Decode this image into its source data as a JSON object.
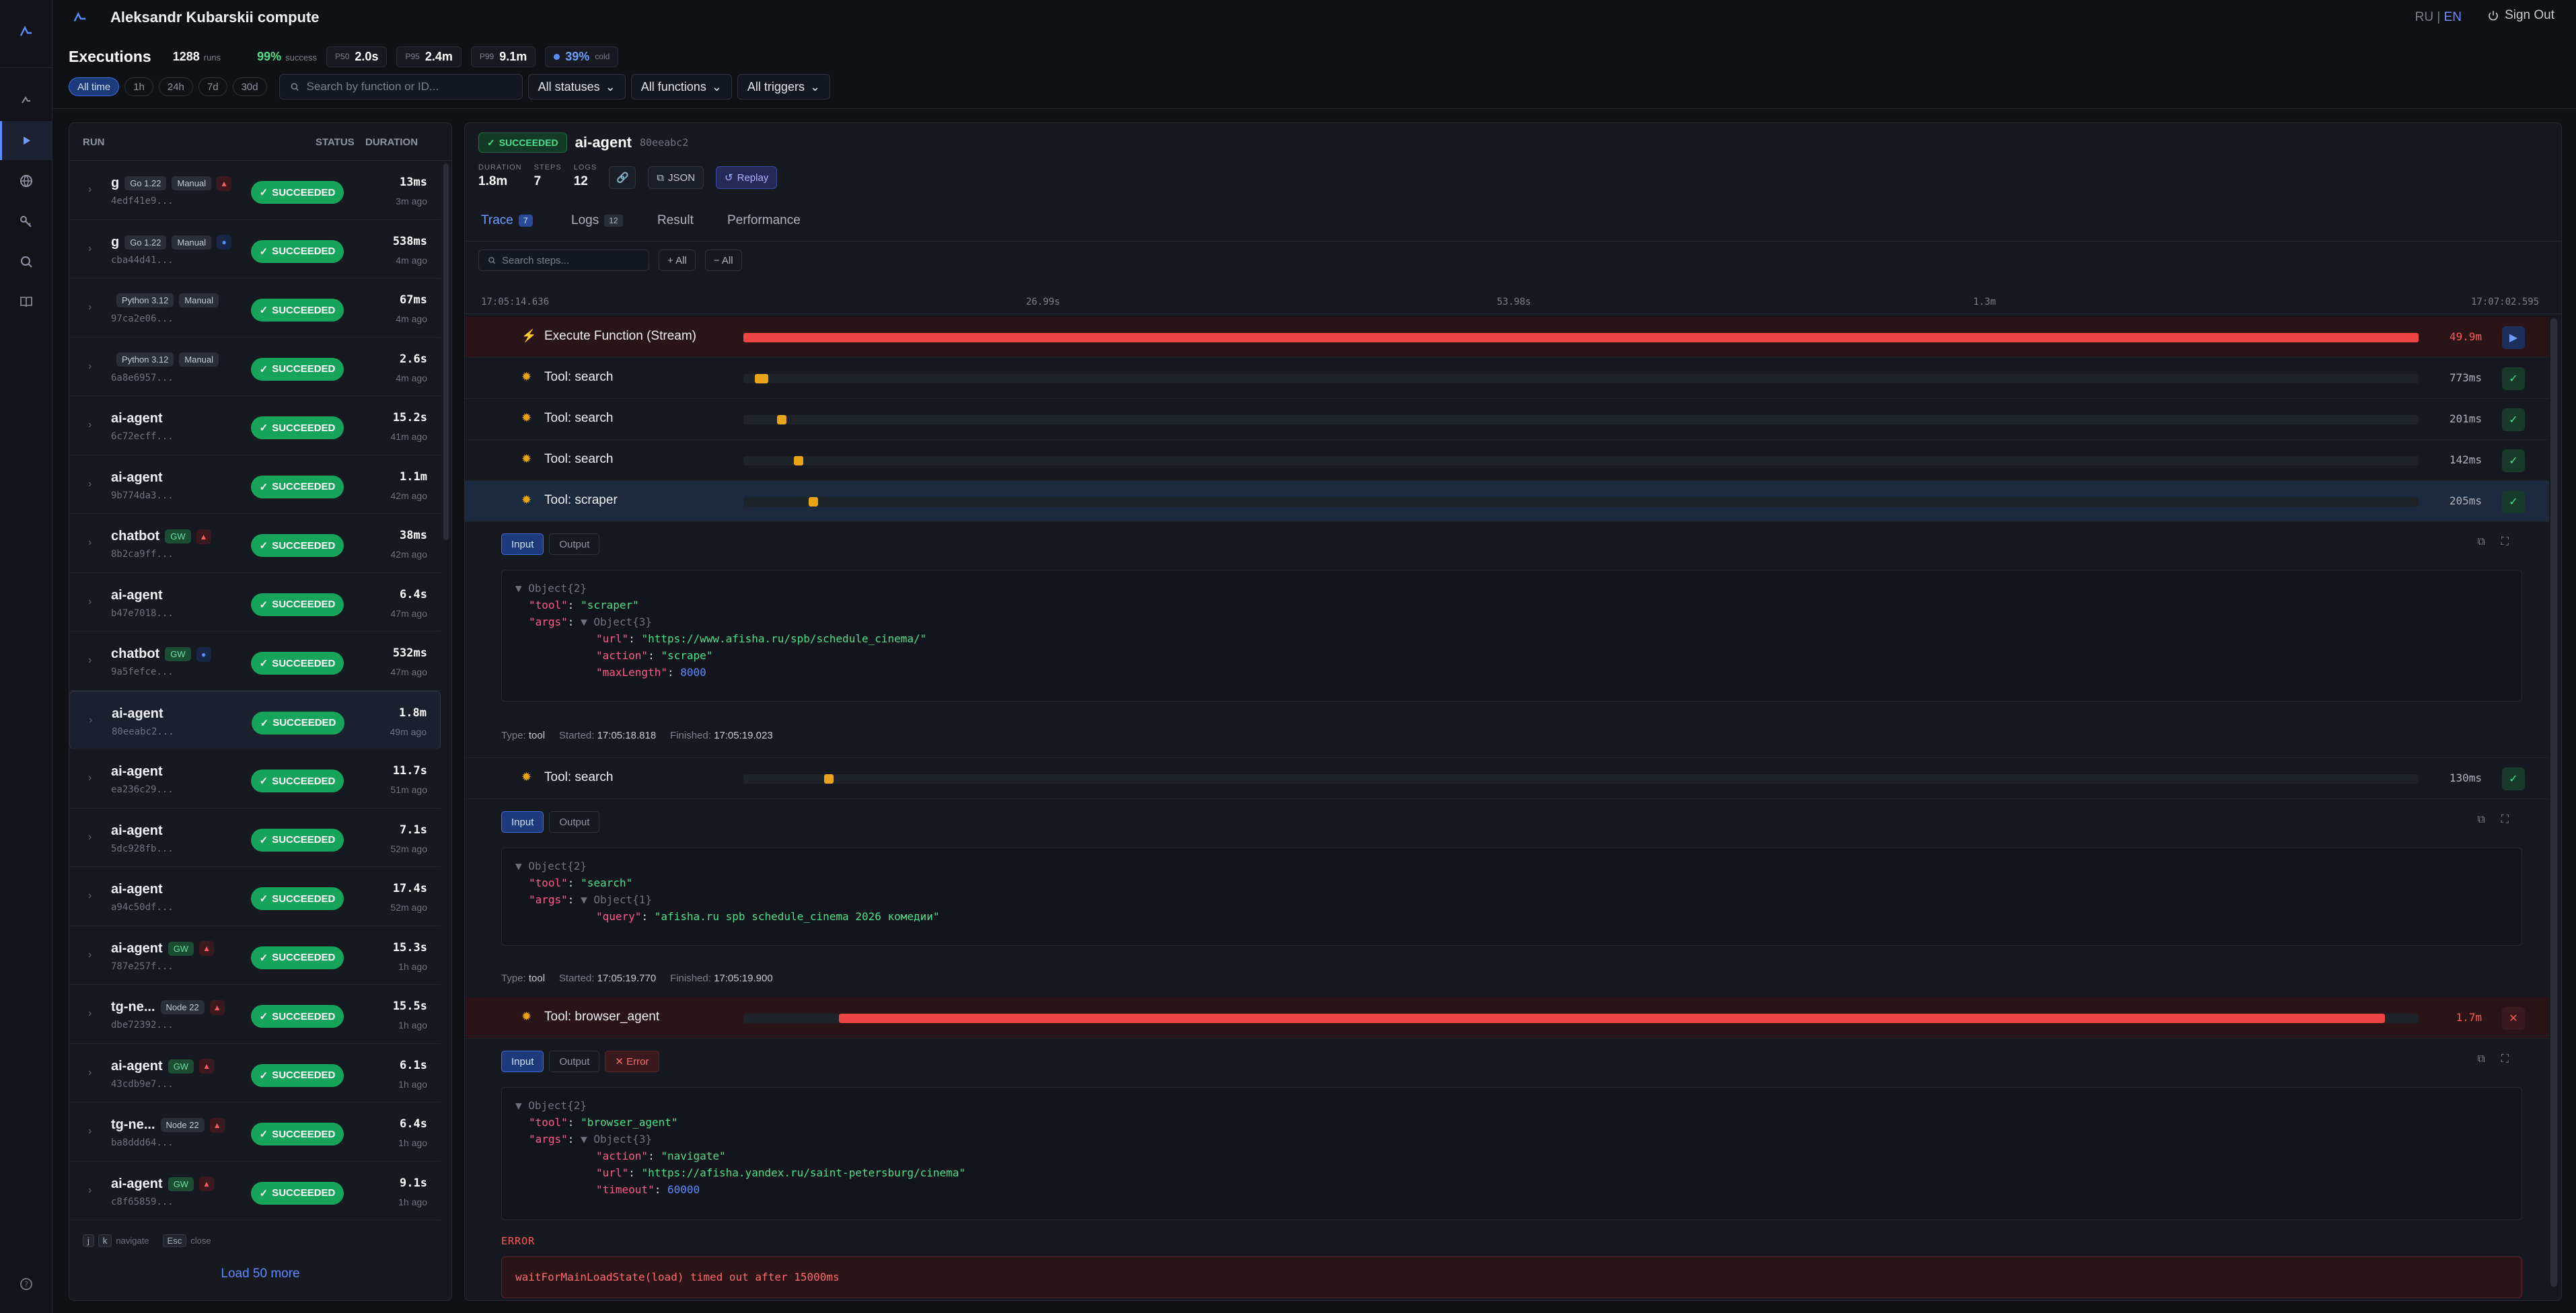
{
  "app": {
    "title": "Aleksandr Kubarskii compute",
    "lang_ru": "RU",
    "lang_sep": "|",
    "lang_en": "EN",
    "sign_out": "Sign Out"
  },
  "header": {
    "title": "Executions",
    "runs": "1288",
    "runs_label": "runs",
    "success": "99%",
    "success_label": "success",
    "p50_label": "P50",
    "p50": "2.0s",
    "p95_label": "P95",
    "p95": "2.4m",
    "p99_label": "P99",
    "p99": "9.1m",
    "cold": "39%",
    "cold_label": "cold"
  },
  "filters": {
    "time": [
      "All time",
      "1h",
      "24h",
      "7d",
      "30d"
    ],
    "search_placeholder": "Search by function or ID...",
    "statuses": "All statuses",
    "functions": "All functions",
    "triggers": "All triggers"
  },
  "list": {
    "col_run": "RUN",
    "col_status": "STATUS",
    "col_duration": "DURATION",
    "rows": [
      {
        "name": "g",
        "tags": [
          "Go 1.22",
          "Manual"
        ],
        "icon": "tri",
        "id": "4edf41e9...",
        "status": "SUCCEEDED",
        "dur": "13ms",
        "ago": "3m ago"
      },
      {
        "name": "g",
        "tags": [
          "Go 1.22",
          "Manual"
        ],
        "icon": "cir",
        "id": "cba44d41...",
        "status": "SUCCEEDED",
        "dur": "538ms",
        "ago": "4m ago"
      },
      {
        "name": "",
        "tags": [
          "Python 3.12",
          "Manual"
        ],
        "icon": "",
        "id": "97ca2e06...",
        "status": "SUCCEEDED",
        "dur": "67ms",
        "ago": "4m ago"
      },
      {
        "name": "",
        "tags": [
          "Python 3.12",
          "Manual"
        ],
        "icon": "",
        "id": "6a8e6957...",
        "status": "SUCCEEDED",
        "dur": "2.6s",
        "ago": "4m ago"
      },
      {
        "name": "ai-agent",
        "tags": [],
        "icon": "",
        "id": "6c72ecff...",
        "status": "SUCCEEDED",
        "dur": "15.2s",
        "ago": "41m ago"
      },
      {
        "name": "ai-agent",
        "tags": [],
        "icon": "",
        "id": "9b774da3...",
        "status": "SUCCEEDED",
        "dur": "1.1m",
        "ago": "42m ago"
      },
      {
        "name": "chatbot",
        "tags": [
          "GW"
        ],
        "icon": "tri",
        "id": "8b2ca9ff...",
        "status": "SUCCEEDED",
        "dur": "38ms",
        "ago": "42m ago"
      },
      {
        "name": "ai-agent",
        "tags": [],
        "icon": "",
        "id": "b47e7018...",
        "status": "SUCCEEDED",
        "dur": "6.4s",
        "ago": "47m ago"
      },
      {
        "name": "chatbot",
        "tags": [
          "GW"
        ],
        "icon": "cir",
        "id": "9a5fefce...",
        "status": "SUCCEEDED",
        "dur": "532ms",
        "ago": "47m ago"
      },
      {
        "name": "ai-agent",
        "tags": [],
        "icon": "",
        "id": "80eeabc2...",
        "status": "SUCCEEDED",
        "dur": "1.8m",
        "ago": "49m ago"
      },
      {
        "name": "ai-agent",
        "tags": [],
        "icon": "",
        "id": "ea236c29...",
        "status": "SUCCEEDED",
        "dur": "11.7s",
        "ago": "51m ago"
      },
      {
        "name": "ai-agent",
        "tags": [],
        "icon": "",
        "id": "5dc928fb...",
        "status": "SUCCEEDED",
        "dur": "7.1s",
        "ago": "52m ago"
      },
      {
        "name": "ai-agent",
        "tags": [],
        "icon": "",
        "id": "a94c50df...",
        "status": "SUCCEEDED",
        "dur": "17.4s",
        "ago": "52m ago"
      },
      {
        "name": "ai-agent",
        "tags": [
          "GW"
        ],
        "icon": "tri",
        "id": "787e257f...",
        "status": "SUCCEEDED",
        "dur": "15.3s",
        "ago": "1h ago"
      },
      {
        "name": "tg-ne...",
        "tags": [
          "Node 22"
        ],
        "icon": "tri",
        "id": "dbe72392...",
        "status": "SUCCEEDED",
        "dur": "15.5s",
        "ago": "1h ago"
      },
      {
        "name": "ai-agent",
        "tags": [
          "GW"
        ],
        "icon": "tri",
        "id": "43cdb9e7...",
        "status": "SUCCEEDED",
        "dur": "6.1s",
        "ago": "1h ago"
      },
      {
        "name": "tg-ne...",
        "tags": [
          "Node 22"
        ],
        "icon": "tri",
        "id": "ba8ddd64...",
        "status": "SUCCEEDED",
        "dur": "6.4s",
        "ago": "1h ago"
      },
      {
        "name": "ai-agent",
        "tags": [
          "GW"
        ],
        "icon": "tri",
        "id": "c8f65859...",
        "status": "SUCCEEDED",
        "dur": "9.1s",
        "ago": "1h ago"
      }
    ],
    "kb_j": "j",
    "kb_k": "k",
    "kb_nav": "navigate",
    "kb_esc": "Esc",
    "kb_close": "close",
    "load_more": "Load 50 more"
  },
  "detail": {
    "status": "SUCCEEDED",
    "fn": "ai-agent",
    "hash": "80eeabc2",
    "duration_label": "DURATION",
    "duration": "1.8m",
    "steps_label": "STEPS",
    "steps": "7",
    "logs_label": "LOGS",
    "logs": "12",
    "json": "JSON",
    "replay": "Replay",
    "tabs": [
      {
        "label": "Trace",
        "count": "7"
      },
      {
        "label": "Logs",
        "count": "12"
      },
      {
        "label": "Result",
        "count": ""
      },
      {
        "label": "Performance",
        "count": ""
      }
    ],
    "search_steps": "Search steps...",
    "expand_all": "+ All",
    "collapse_all": "− All",
    "ruler": [
      "17:05:14.636",
      "26.99s",
      "53.98s",
      "1.3m",
      "17:07:02.595"
    ],
    "spans": [
      {
        "name": "Execute Function (Stream)",
        "dur": "49.9m",
        "kind": "stream",
        "start": 0,
        "width": 1
      },
      {
        "name": "Tool: search",
        "dur": "773ms",
        "kind": "tool",
        "start": 0.007,
        "width": 0.008
      },
      {
        "name": "Tool: search",
        "dur": "201ms",
        "kind": "tool",
        "start": 0.02,
        "width": 0.005
      },
      {
        "name": "Tool: search",
        "dur": "142ms",
        "kind": "tool",
        "start": 0.03,
        "width": 0.004
      },
      {
        "name": "Tool: scraper",
        "dur": "205ms",
        "kind": "tool",
        "start": 0.039,
        "width": 0.005
      },
      {
        "name": "Tool: search",
        "dur": "130ms",
        "kind": "tool",
        "start": 0.048,
        "width": 0.004
      },
      {
        "name": "Tool: browser_agent",
        "dur": "1.7m",
        "kind": "err",
        "start": 0.057,
        "width": 0.923
      }
    ],
    "input": "Input",
    "output": "Output",
    "error": "Error",
    "d1": {
      "l1": "▼ Object{2}",
      "l2k": "\"tool\"",
      "l2v": "\"scraper\"",
      "l3k": "\"args\"",
      "l3v": "▼ Object{3}",
      "l4k": "\"url\"",
      "l4v": "\"https://www.afisha.ru/spb/schedule_cinema/\"",
      "l5k": "\"action\"",
      "l5v": "\"scrape\"",
      "l6k": "\"maxLength\"",
      "l6v": "8000",
      "type_l": "Type:",
      "type": "tool",
      "st_l": "Started:",
      "st": "17:05:18.818",
      "fi_l": "Finished:",
      "fi": "17:05:19.023"
    },
    "d2": {
      "l1": "▼ Object{2}",
      "l2k": "\"tool\"",
      "l2v": "\"search\"",
      "l3k": "\"args\"",
      "l3v": "▼ Object{1}",
      "l4k": "\"query\"",
      "l4v": "\"afisha.ru spb schedule_cinema 2026 комедии\"",
      "type_l": "Type:",
      "type": "tool",
      "st_l": "Started:",
      "st": "17:05:19.770",
      "fi_l": "Finished:",
      "fi": "17:05:19.900"
    },
    "d3": {
      "l1": "▼ Object{2}",
      "l2k": "\"tool\"",
      "l2v": "\"browser_agent\"",
      "l3k": "\"args\"",
      "l3v": "▼ Object{3}",
      "l4k": "\"action\"",
      "l4v": "\"navigate\"",
      "l5k": "\"url\"",
      "l5v": "\"https://afisha.yandex.ru/saint-petersburg/cinema\"",
      "l6k": "\"timeout\"",
      "l6v": "60000",
      "err_label": "ERROR",
      "err_msg": "waitForMainLoadState(load) timed out after 15000ms"
    }
  },
  "colors": {
    "accent": "#5b8cff",
    "success": "#16a35a",
    "error": "#ef4444",
    "tool": "#e8a317"
  }
}
